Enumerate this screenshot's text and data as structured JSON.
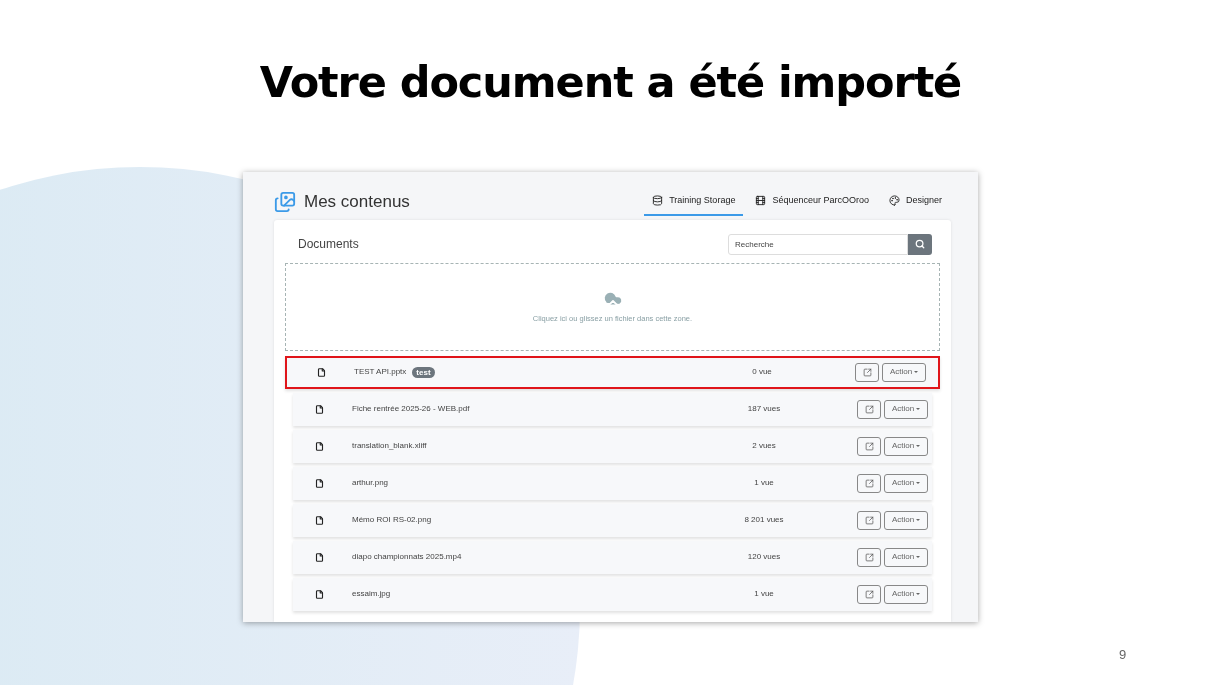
{
  "slide": {
    "title": "Votre document a été importé",
    "page_number": "9"
  },
  "app": {
    "title": "Mes contenus",
    "tabs": [
      {
        "label": "Training Storage",
        "selected": true,
        "kind": "storage"
      },
      {
        "label": "Séquenceur ParcOOroo",
        "selected": false,
        "kind": "sequencer"
      },
      {
        "label": "Designer",
        "selected": false,
        "kind": "palette"
      }
    ],
    "panel_title": "Documents",
    "search": {
      "placeholder": "Recherche"
    },
    "dropzone": {
      "hint": "Cliquez ici ou glissez un fichier dans cette zone."
    },
    "documents": [
      {
        "name": "TEST API.pptx",
        "tag": "test",
        "views": "0 vue",
        "action": "Action",
        "highlighted": true
      },
      {
        "name": "Fiche rentrée 2025-26 - WEB.pdf",
        "views": "187 vues",
        "action": "Action",
        "highlighted": false
      },
      {
        "name": "translation_blank.xliff",
        "views": "2 vues",
        "action": "Action",
        "highlighted": false
      },
      {
        "name": "arthur.png",
        "views": "1 vue",
        "action": "Action",
        "highlighted": false
      },
      {
        "name": "Mémo ROI RS-02.png",
        "views": "8 201 vues",
        "action": "Action",
        "highlighted": false
      },
      {
        "name": "diapo championnats 2025.mp4",
        "views": "120 vues",
        "action": "Action",
        "highlighted": false
      },
      {
        "name": "essaim.jpg",
        "views": "1 vue",
        "action": "Action",
        "highlighted": false
      }
    ]
  }
}
